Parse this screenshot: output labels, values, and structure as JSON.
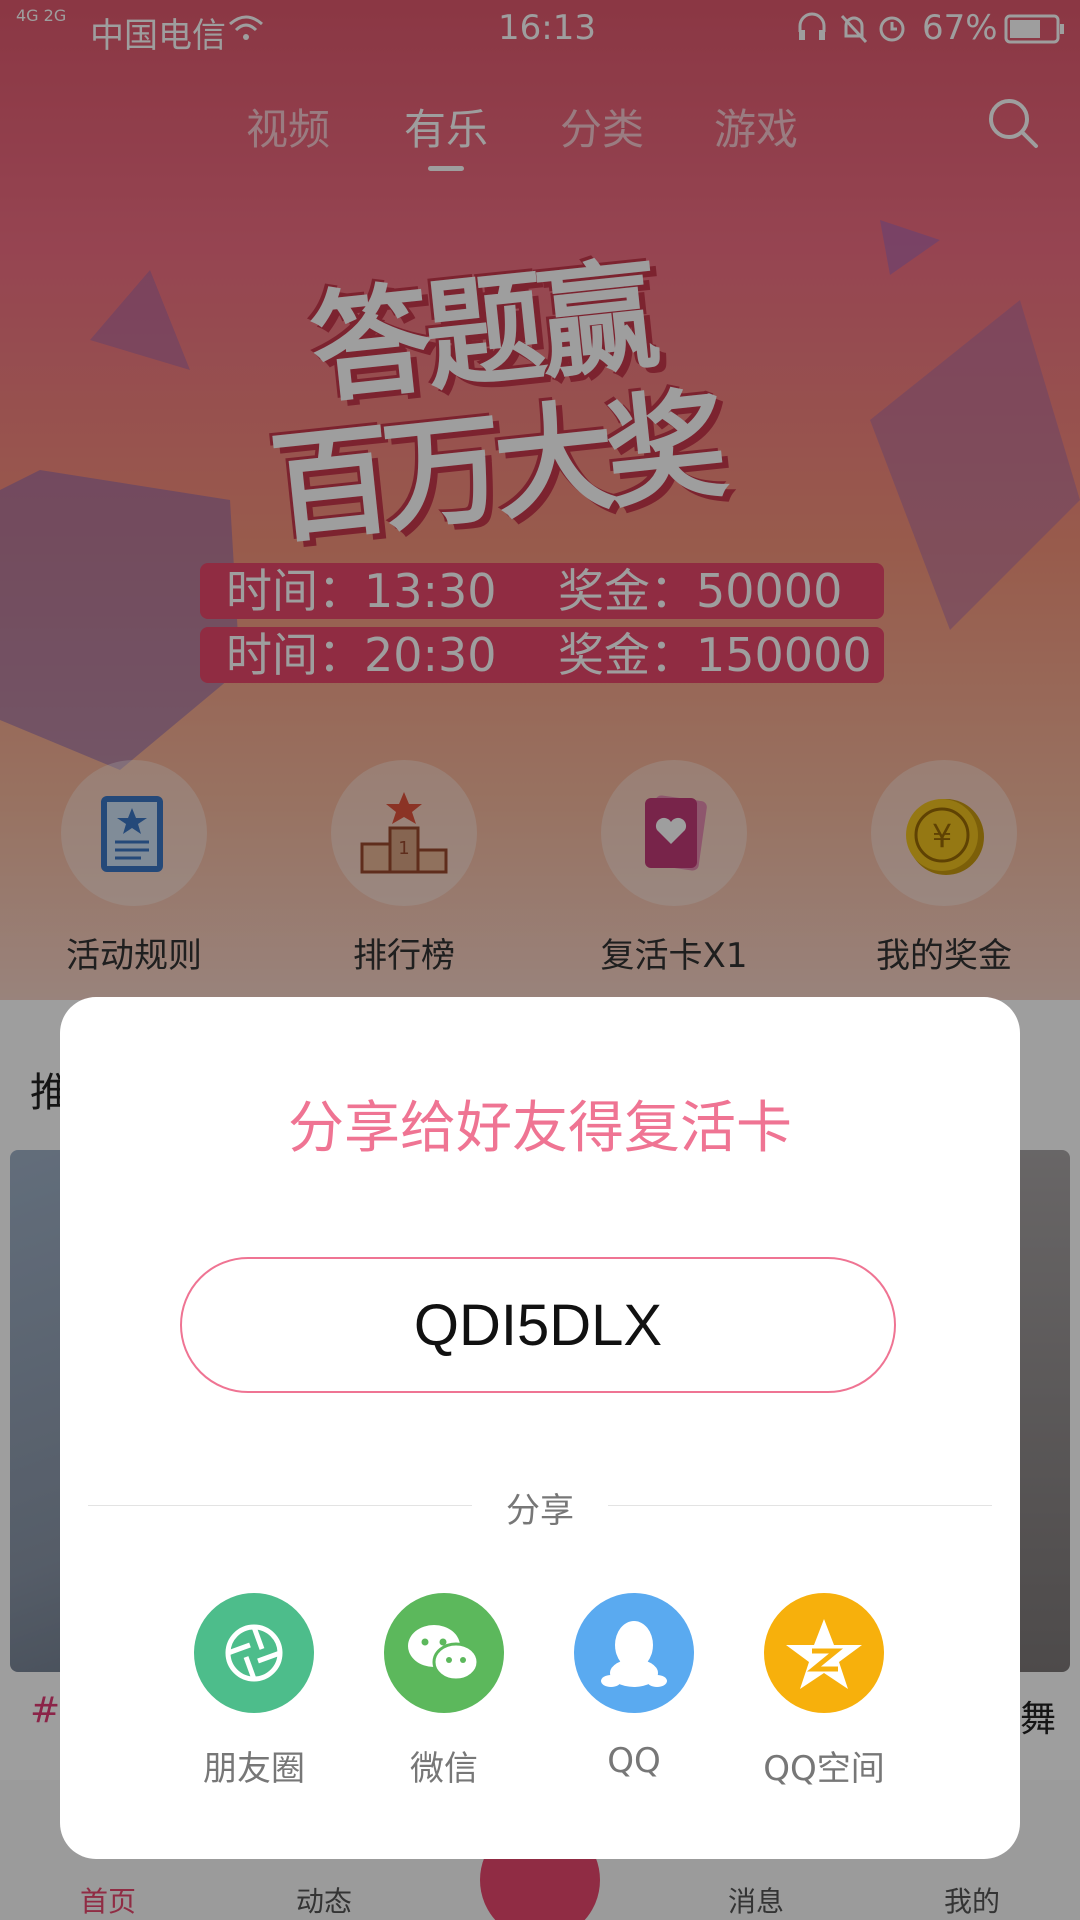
{
  "status_bar": {
    "network": "4G 2G",
    "carrier": "中国电信",
    "time": "16:13",
    "battery": "67%"
  },
  "top_nav": {
    "tabs": [
      "视频",
      "有乐",
      "分类",
      "游戏"
    ],
    "active_tab": "有乐"
  },
  "banner": {
    "title_line1": "答题赢",
    "title_line2": "百万大奖",
    "schedule": [
      {
        "time": "时间：13:30",
        "prize": "奖金：50000"
      },
      {
        "time": "时间：20:30",
        "prize": "奖金：150000"
      }
    ]
  },
  "actions": [
    {
      "label": "活动规则",
      "icon": "rules-scroll-icon"
    },
    {
      "label": "排行榜",
      "icon": "podium-icon"
    },
    {
      "label": "复活卡X1",
      "icon": "revive-card-icon"
    },
    {
      "label": "我的奖金",
      "icon": "coin-icon"
    }
  ],
  "feed": {
    "section_partial": "推",
    "tag_partial": "#",
    "right_partial": "舞"
  },
  "tabbar": {
    "items": [
      "首页",
      "动态",
      "消息",
      "我的"
    ],
    "active": "首页"
  },
  "modal": {
    "title": "分享给好友得复活卡",
    "code": "QDI5DLX",
    "share_label": "分享",
    "share_targets": [
      {
        "label": "朋友圈",
        "icon": "moments-icon",
        "color": "#4dbd8b"
      },
      {
        "label": "微信",
        "icon": "wechat-icon",
        "color": "#5cb85c"
      },
      {
        "label": "QQ",
        "icon": "qq-icon",
        "color": "#5aaaf0"
      },
      {
        "label": "QQ空间",
        "icon": "qzone-icon",
        "color": "#f7b00c"
      }
    ]
  }
}
